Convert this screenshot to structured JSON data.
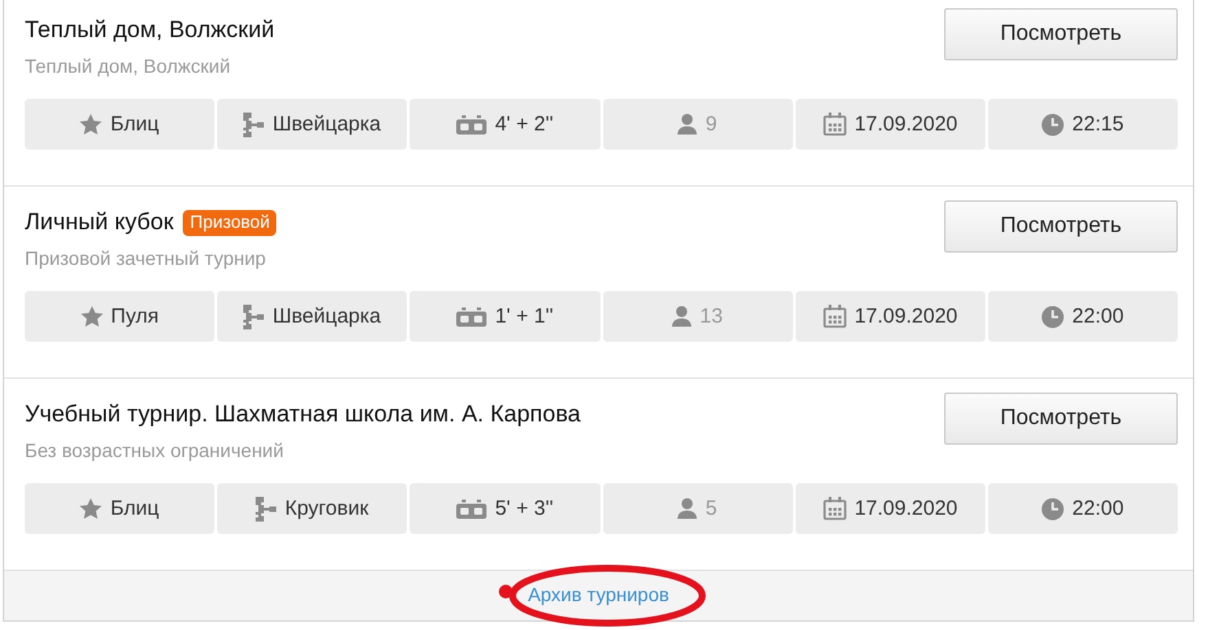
{
  "tournaments": [
    {
      "title": "Теплый дом, Волжский",
      "subtitle": "Теплый дом, Волжский",
      "button": "Посмотреть",
      "chips": [
        {
          "kind": "type",
          "text": "Блиц"
        },
        {
          "kind": "system",
          "text": "Швейцарка"
        },
        {
          "kind": "control",
          "text": "4' + 2''"
        },
        {
          "kind": "players",
          "text": "9"
        },
        {
          "kind": "date",
          "text": "17.09.2020"
        },
        {
          "kind": "time",
          "text": "22:15"
        }
      ]
    },
    {
      "title": "Личный кубок",
      "badge": "Призовой",
      "subtitle": "Призовой зачетный турнир",
      "button": "Посмотреть",
      "chips": [
        {
          "kind": "type",
          "text": "Пуля"
        },
        {
          "kind": "system",
          "text": "Швейцарка"
        },
        {
          "kind": "control",
          "text": "1' + 1''"
        },
        {
          "kind": "players",
          "text": "13"
        },
        {
          "kind": "date",
          "text": "17.09.2020"
        },
        {
          "kind": "time",
          "text": "22:00"
        }
      ]
    },
    {
      "title": "Учебный турнир. Шахматная школа им. А. Карпова",
      "subtitle": "Без возрастных ограничений",
      "button": "Посмотреть",
      "chips": [
        {
          "kind": "type",
          "text": "Блиц"
        },
        {
          "kind": "system",
          "text": "Круговик"
        },
        {
          "kind": "control",
          "text": "5' + 3''"
        },
        {
          "kind": "players",
          "text": "5"
        },
        {
          "kind": "date",
          "text": "17.09.2020"
        },
        {
          "kind": "time",
          "text": "22:00"
        }
      ]
    }
  ],
  "footer": {
    "link": "Архив турниров",
    "circled": true
  }
}
